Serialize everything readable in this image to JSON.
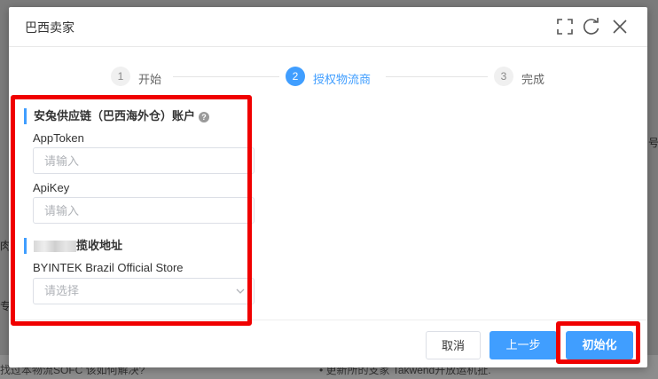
{
  "background": {
    "right_fragment": "号",
    "left_fragment_1": "肉,",
    "left_fragment_2": "专帖",
    "bottom_left": "找过本物流SOFC 该如何解决?",
    "bottom_right": "• 更新所的支家 Takwend开放运机扯."
  },
  "modal": {
    "title": "巴西卖家",
    "icons": [
      "fullscreen-icon",
      "refresh-icon",
      "close-icon"
    ]
  },
  "steps": [
    {
      "number": "1",
      "label": "开始",
      "state": "done"
    },
    {
      "number": "2",
      "label": "授权物流商",
      "state": "active"
    },
    {
      "number": "3",
      "label": "完成",
      "state": "pending"
    }
  ],
  "form": {
    "section1_title": "安兔供应链（巴西海外仓）账户",
    "apptoken_label": "AppToken",
    "apptoken_placeholder": "请输入",
    "apikey_label": "ApiKey",
    "apikey_placeholder": "请输入",
    "section2_title_suffix": "揽收地址",
    "store_label": "BYINTEK Brazil Official Store",
    "store_placeholder": "请选择"
  },
  "footer": {
    "cancel_label": "取消",
    "prev_label": "上一步",
    "init_label": "初始化"
  },
  "colors": {
    "primary": "#409eff",
    "highlight_red": "#f00000"
  }
}
